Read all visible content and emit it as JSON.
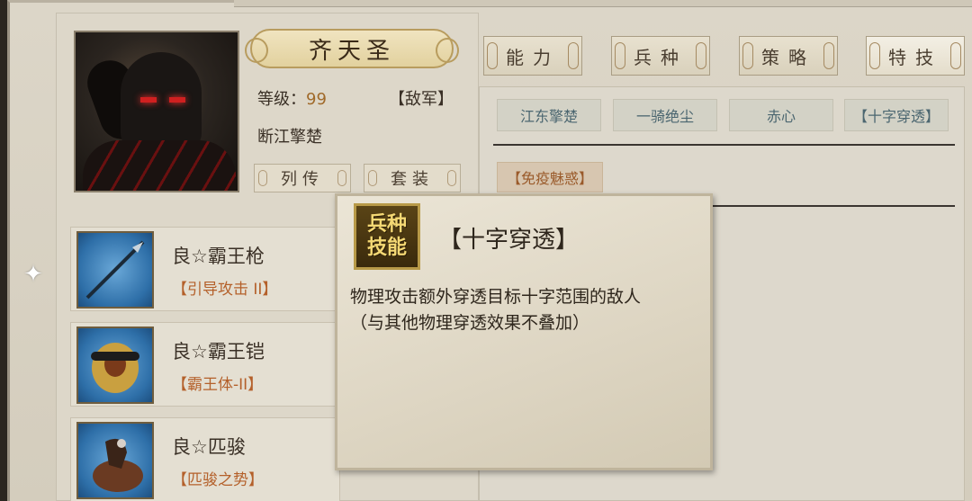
{
  "general": {
    "name": "齐天圣",
    "level_label": "等级：",
    "level_value": "99",
    "side": "【敌军】",
    "title": "断江擎楚"
  },
  "buttons": {
    "biography": "列传",
    "outfit": "套装"
  },
  "tabs": [
    {
      "label": "能力"
    },
    {
      "label": "兵种"
    },
    {
      "label": "策略"
    },
    {
      "label": "特技"
    }
  ],
  "skills": [
    {
      "label": "江东擎楚"
    },
    {
      "label": "一骑绝尘"
    },
    {
      "label": "赤心"
    },
    {
      "label": "【十字穿透】"
    }
  ],
  "immune_skill": "【免疫魅惑】",
  "equipment": [
    {
      "name": "良☆霸王枪",
      "skill": "【引导攻击 II】",
      "icon": "spear-icon"
    },
    {
      "name": "良☆霸王铠",
      "skill": "【霸王体-II】",
      "icon": "armor-icon"
    },
    {
      "name": "良☆匹骏",
      "skill": "【匹骏之势】",
      "icon": "horse-icon"
    }
  ],
  "tooltip": {
    "badge_line1": "兵种",
    "badge_line2": "技能",
    "title": "【十字穿透】",
    "desc_line1": "物理攻击额外穿透目标十字范围的敌人",
    "desc_line2": "（与其他物理穿透效果不叠加）"
  },
  "colors": {
    "accent_orange": "#a06a2a",
    "chip_text": "#4b6670",
    "badge_gold": "#f4d874"
  }
}
